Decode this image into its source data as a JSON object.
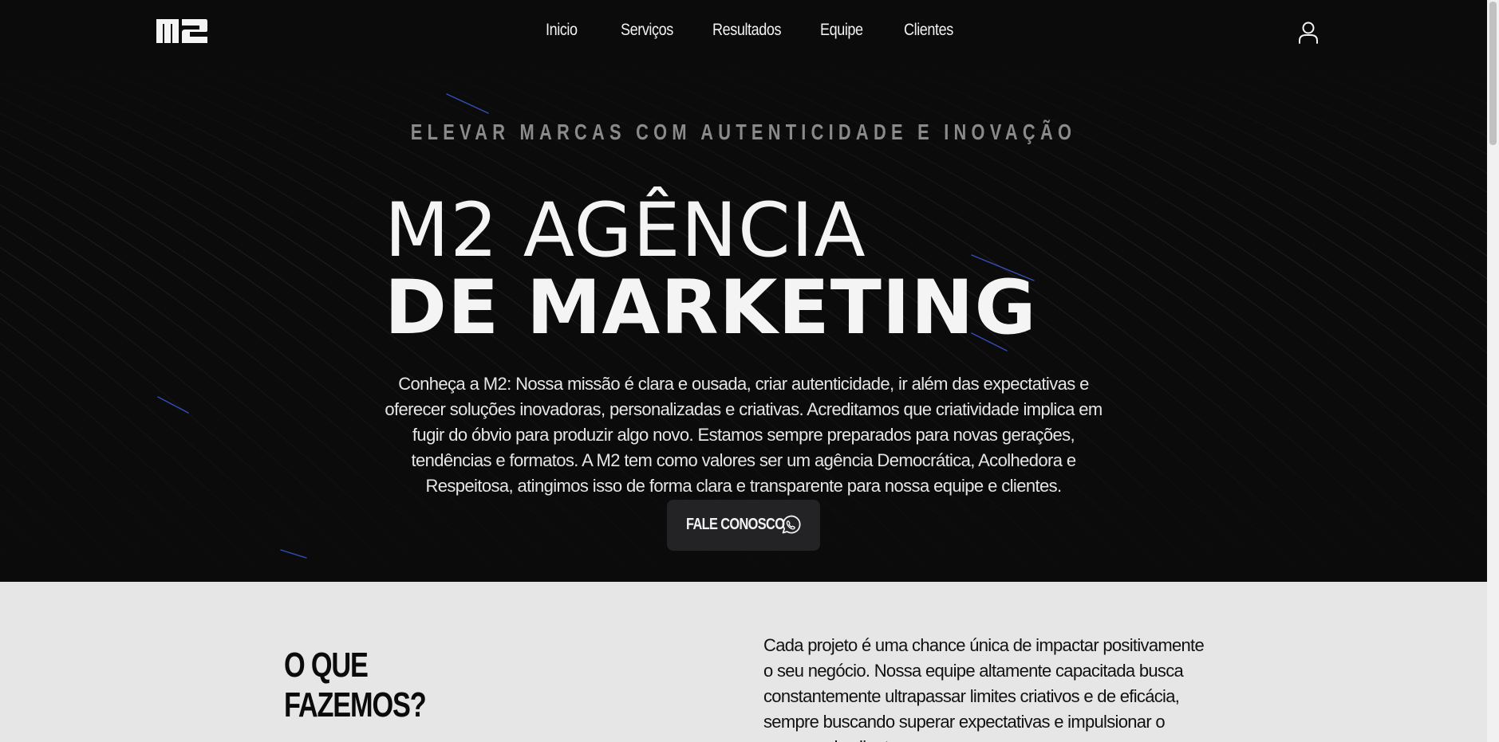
{
  "nav": {
    "logo_text": "M2",
    "links": [
      "Inicio",
      "Serviços",
      "Resultados",
      "Equipe",
      "Clientes"
    ],
    "user_icon": "user-icon"
  },
  "hero": {
    "tagline": "ELEVAR MARCAS COM AUTENTICIDADE E INOVAÇÃO",
    "title_line1": "M2 AGÊNCIA",
    "title_line2": "DE MARKETING",
    "description": "Conheça a M2: Nossa missão é clara e ousada, criar autenticidade, ir além das expectativas e oferecer soluções inovadoras, personalizadas e criativas. Acreditamos que criatividade implica em fugir do óbvio para produzir algo novo. Estamos sempre preparados para novas gerações, tendências e formatos. A M2 tem como valores ser um agência Democrática, Acolhedora e Respeitosa, atingimos isso de forma clara e transparente para nossa equipe e clientes.",
    "cta_label": "FALE CONOSCO",
    "cta_icon": "whatsapp-icon"
  },
  "what_we_do": {
    "title_line1": "O QUE",
    "title_line2": "FAZEMOS?",
    "text": "Cada projeto é uma chance única de impactar positivamente o seu negócio. Nossa equipe altamente capacitada busca constantemente ultrapassar limites criativos e de eficácia, sempre buscando superar expectativas e impulsionar o sucesso do cliente."
  },
  "colors": {
    "hero_bg": "#0b0b0c",
    "section_bg": "#e6e6e6",
    "accent_lines": "#3b5bd6",
    "text_light": "#f4f4f4",
    "tagline": "#8a8a8a",
    "button_bg": "#232325"
  }
}
